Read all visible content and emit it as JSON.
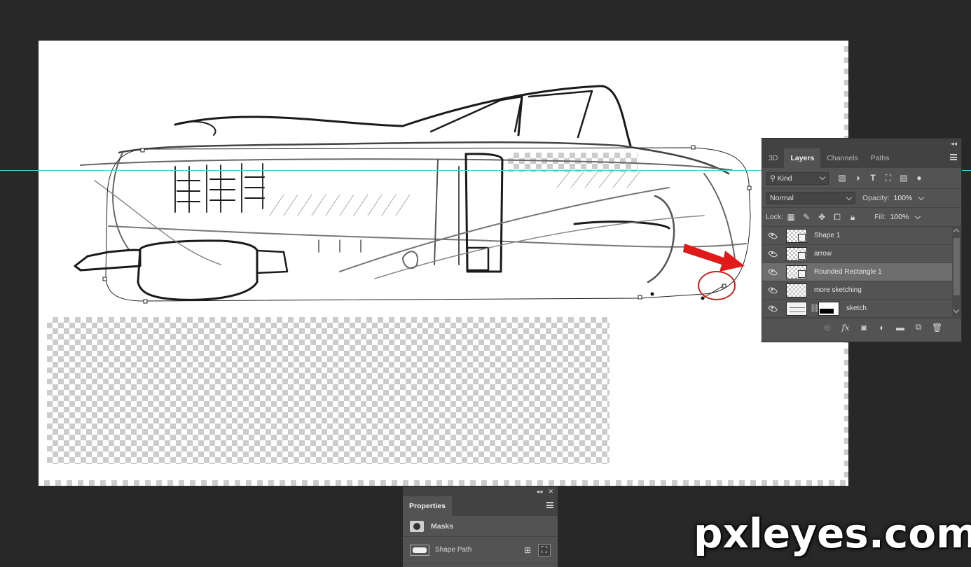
{
  "layers_panel": {
    "tabs": [
      {
        "label": "3D",
        "active": false
      },
      {
        "label": "Layers",
        "active": true
      },
      {
        "label": "Channels",
        "active": false
      },
      {
        "label": "Paths",
        "active": false
      }
    ],
    "filter": {
      "label": "Kind"
    },
    "filter_icons": [
      "image-filter-icon",
      "adjustment-filter-icon",
      "type-filter-icon",
      "shape-filter-icon",
      "smart-object-filter-icon",
      "filter-toggle-icon"
    ],
    "blend_mode": "Normal",
    "opacity_label": "Opacity:",
    "opacity_value": "100%",
    "lock_label": "Lock:",
    "lock_icons": [
      "lock-transparent-icon",
      "lock-brush-icon",
      "lock-move-icon",
      "lock-artboard-icon",
      "lock-all-icon"
    ],
    "fill_label": "Fill:",
    "fill_value": "100%",
    "layers": [
      {
        "name": "Shape 1",
        "visible": true,
        "selected": false,
        "kind": "shape"
      },
      {
        "name": "arrow",
        "visible": true,
        "selected": false,
        "kind": "shape"
      },
      {
        "name": "Rounded Rectangle 1",
        "visible": true,
        "selected": true,
        "kind": "shape"
      },
      {
        "name": "more sketching",
        "visible": true,
        "selected": false,
        "kind": "pixel"
      },
      {
        "name": "sketch",
        "visible": true,
        "selected": false,
        "kind": "masked"
      }
    ],
    "bottom_icons": [
      "link-icon",
      "fx-icon",
      "add-mask-icon",
      "adjustment-icon",
      "folder-icon",
      "new-layer-icon",
      "trash-icon"
    ]
  },
  "properties_panel": {
    "tab": "Properties",
    "section": "Masks",
    "item": "Shape Path"
  },
  "watermark": "pxleyes.com",
  "colors": {
    "workspace": "#282828",
    "panel": "#535353",
    "panel_dark": "#424242",
    "selected_layer": "#6e6e6e",
    "guide": "#3ed0e0",
    "annotation_red": "#e01a1a"
  }
}
